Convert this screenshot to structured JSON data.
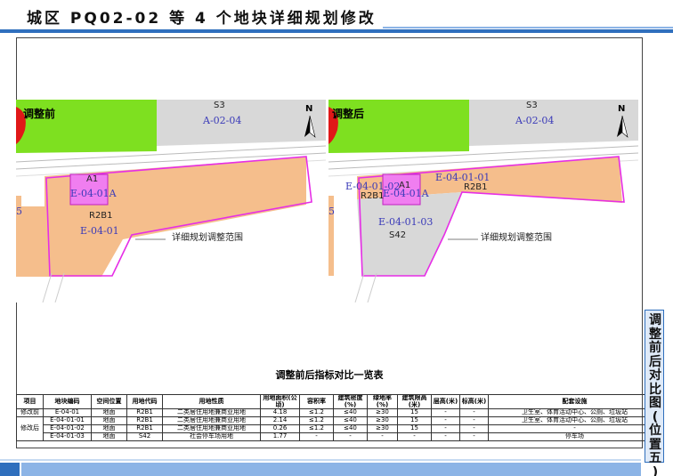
{
  "header": {
    "title": "城区 PQ02-02 等 4 个地块详细规划修改"
  },
  "side_tab": {
    "text": "调整前后对比图(位置五)"
  },
  "colors": {
    "accent": "#2f6fbd",
    "commercial": "#f5be8c",
    "green": "#7ee020",
    "grey": "#d8d8d8",
    "boundary": "#e62ee6",
    "red": "#e01818"
  },
  "map_before": {
    "heading": "调整前",
    "s3": "S3",
    "a_code": "A-02-04",
    "a1": "A1",
    "e0401a": "E-04-01A",
    "r2b1": "R2B1",
    "e0401": "E-04-01",
    "edge": "5",
    "callout": "详细规划调整范围",
    "north": "N",
    "north_icon": "north-arrow-icon"
  },
  "map_after": {
    "heading": "调整后",
    "s3": "S3",
    "a_code": "A-02-04",
    "e040102": "E-04-01-02",
    "a1": "A1",
    "e0401a": "E-04-01A",
    "r2b1_left": "R2B1",
    "e040101": "E-04-01-01",
    "r2b1_right": "R2B1",
    "e040103": "E-04-01-03",
    "s42": "S42",
    "edge": "5",
    "callout": "详细规划调整范围",
    "north": "N"
  },
  "table": {
    "title": "调整前后指标对比一览表",
    "headers": [
      "项目",
      "地块编码",
      "空间位置",
      "用地代码",
      "用地性质",
      "用地面积(公顷)",
      "容积率",
      "建筑密度(%)",
      "绿地率(%)",
      "建筑限高(米)",
      "层高(米)",
      "标高(米)",
      "配套设施"
    ],
    "group_before": "修改前",
    "group_after": "修改后",
    "rows": [
      [
        "E-04-01",
        "地面",
        "R2B1",
        "二类居住用地兼商业用地",
        "4.18",
        "≤1.2",
        "≤40",
        "≥30",
        "15",
        "-",
        "-",
        "卫生室、体育活动中心、公厕、垃圾站"
      ],
      [
        "E-04-01-01",
        "地面",
        "R2B1",
        "二类居住用地兼商业用地",
        "2.14",
        "≤1.2",
        "≤40",
        "≥30",
        "15",
        "-",
        "-",
        "卫生室、体育活动中心、公厕、垃圾站"
      ],
      [
        "E-04-01-02",
        "地面",
        "R2B1",
        "二类居住用地兼商业用地",
        "0.26",
        "≤1.2",
        "≤40",
        "≥30",
        "15",
        "-",
        "-",
        "-"
      ],
      [
        "E-04-01-03",
        "地面",
        "S42",
        "社会停车场用地",
        "1.77",
        "-",
        "-",
        "-",
        "-",
        "-",
        "-",
        "停车场"
      ]
    ]
  }
}
